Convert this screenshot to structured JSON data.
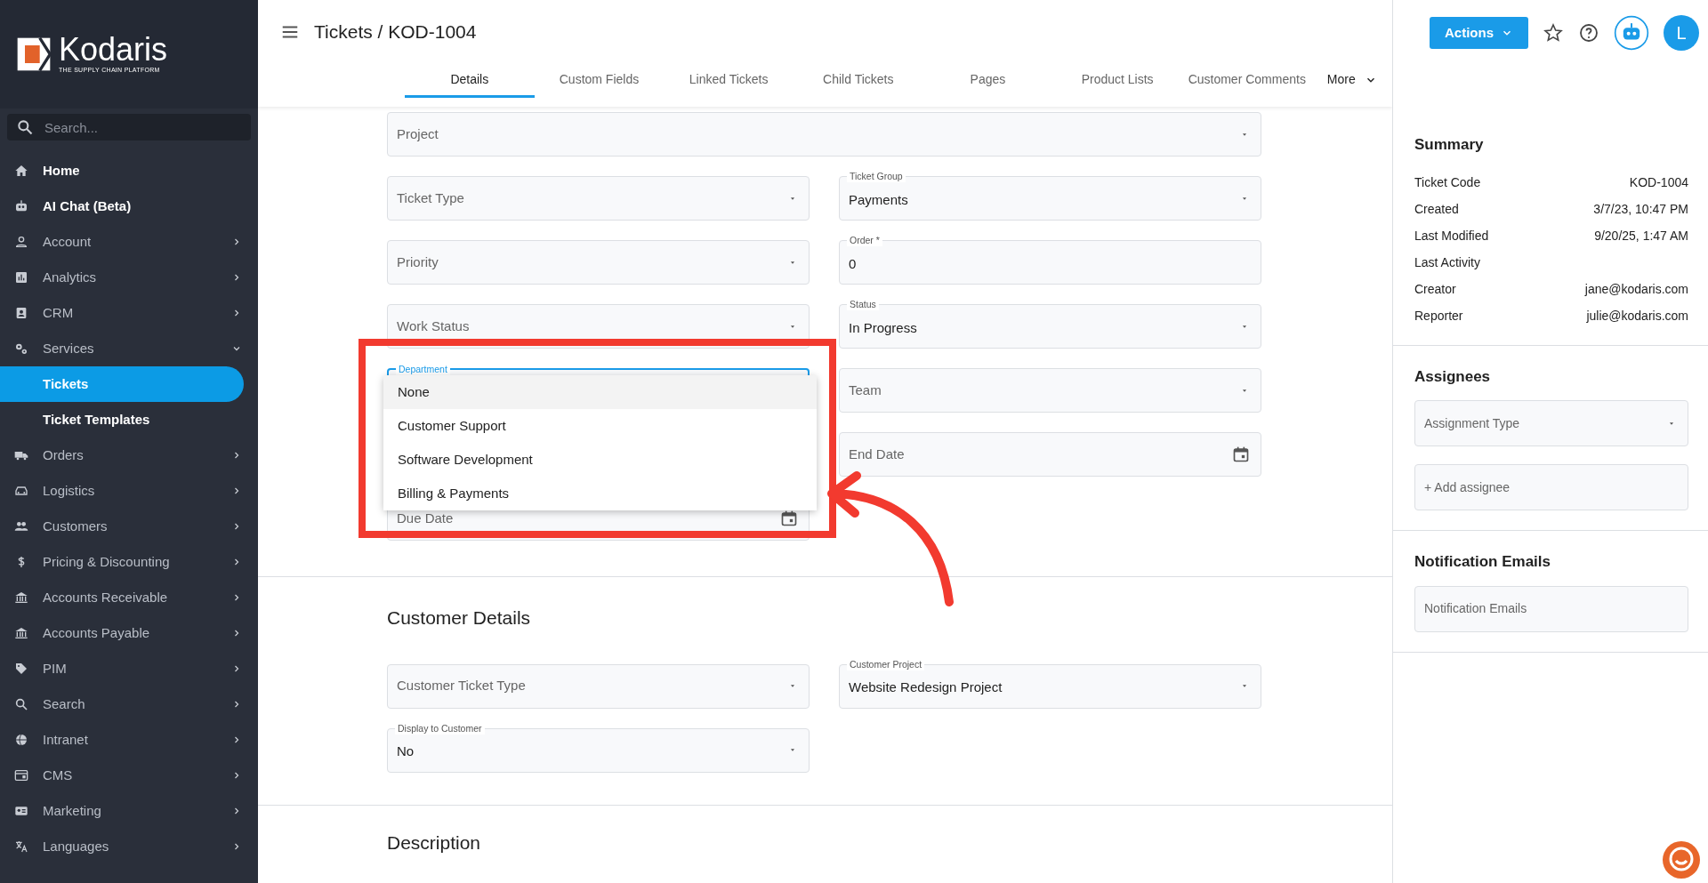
{
  "brand": {
    "name": "Kodaris",
    "tagline": "THE SUPPLY CHAIN PLATFORM"
  },
  "sidebar": {
    "search": {
      "placeholder": "Search..."
    },
    "items": [
      {
        "label": "Home"
      },
      {
        "label": "AI Chat (Beta)"
      },
      {
        "label": "Account",
        "expanded": false
      },
      {
        "label": "Analytics",
        "expanded": false
      },
      {
        "label": "CRM",
        "expanded": false
      },
      {
        "label": "Services",
        "expanded": true,
        "children": [
          {
            "label": "Tickets",
            "selected": true
          },
          {
            "label": "Ticket Templates",
            "selected": false
          }
        ]
      },
      {
        "label": "Orders",
        "expanded": false
      },
      {
        "label": "Logistics",
        "expanded": false
      },
      {
        "label": "Customers",
        "expanded": false
      },
      {
        "label": "Pricing & Discounting",
        "expanded": false
      },
      {
        "label": "Accounts Receivable",
        "expanded": false
      },
      {
        "label": "Accounts Payable",
        "expanded": false
      },
      {
        "label": "PIM",
        "expanded": false
      },
      {
        "label": "Search",
        "expanded": false
      },
      {
        "label": "Intranet",
        "expanded": false
      },
      {
        "label": "CMS",
        "expanded": false
      },
      {
        "label": "Marketing",
        "expanded": false
      },
      {
        "label": "Languages",
        "expanded": false
      }
    ]
  },
  "header": {
    "title": "Tickets / KOD-1004",
    "actions_button": "Actions",
    "avatar": "L"
  },
  "tabs": [
    {
      "label": "Details",
      "selected": true
    },
    {
      "label": "Custom Fields",
      "selected": false
    },
    {
      "label": "Linked Tickets",
      "selected": false
    },
    {
      "label": "Child Tickets",
      "selected": false
    },
    {
      "label": "Pages",
      "selected": false
    },
    {
      "label": "Product Lists",
      "selected": false
    },
    {
      "label": "Customer Comments",
      "selected": false
    },
    {
      "label": "More",
      "selected": false
    }
  ],
  "details_fields": [
    {
      "kind": "select",
      "placeholder": "Project",
      "wide": true
    },
    {
      "kind": "select",
      "placeholder": "Ticket Type"
    },
    {
      "kind": "select",
      "label": "Ticket Group",
      "value": "Payments"
    },
    {
      "kind": "select",
      "placeholder": "Priority"
    },
    {
      "kind": "text",
      "label": "Order *",
      "value": "0"
    },
    {
      "kind": "select",
      "placeholder": "Work Status"
    },
    {
      "kind": "select",
      "label": "Status",
      "value": "In Progress"
    },
    {
      "kind": "select",
      "label": "Department",
      "focused": true,
      "options": [
        {
          "label": "None",
          "selected": true
        },
        {
          "label": "Customer Support",
          "selected": false
        },
        {
          "label": "Software Development",
          "selected": false
        },
        {
          "label": "Billing & Payments",
          "selected": false
        }
      ]
    },
    {
      "kind": "select",
      "placeholder": "Team"
    },
    {
      "kind": "hidden"
    },
    {
      "kind": "date",
      "placeholder": "End Date"
    },
    {
      "kind": "date",
      "placeholder": "Due Date"
    }
  ],
  "customer_details": {
    "title": "Customer Details",
    "fields": [
      {
        "kind": "select",
        "placeholder": "Customer Ticket Type"
      },
      {
        "kind": "select",
        "label": "Customer Project",
        "value": "Website Redesign Project"
      },
      {
        "kind": "select",
        "label": "Display to Customer",
        "value": "No"
      }
    ]
  },
  "description": {
    "title": "Description"
  },
  "summary": {
    "title": "Summary",
    "rows": [
      {
        "label": "Ticket Code",
        "value": "KOD-1004"
      },
      {
        "label": "Created",
        "value": "3/7/23, 10:47 PM"
      },
      {
        "label": "Last Modified",
        "value": "9/20/25, 1:47 AM"
      },
      {
        "label": "Last Activity"
      },
      {
        "label": "Creator",
        "value": "jane@kodaris.com"
      },
      {
        "label": "Reporter",
        "value": "julie@kodaris.com"
      }
    ]
  },
  "assignees": {
    "title": "Assignees",
    "type_placeholder": "Assignment Type",
    "add_placeholder": "+ Add assignee"
  },
  "notification_emails": {
    "title": "Notification Emails",
    "placeholder": "Notification Emails"
  }
}
